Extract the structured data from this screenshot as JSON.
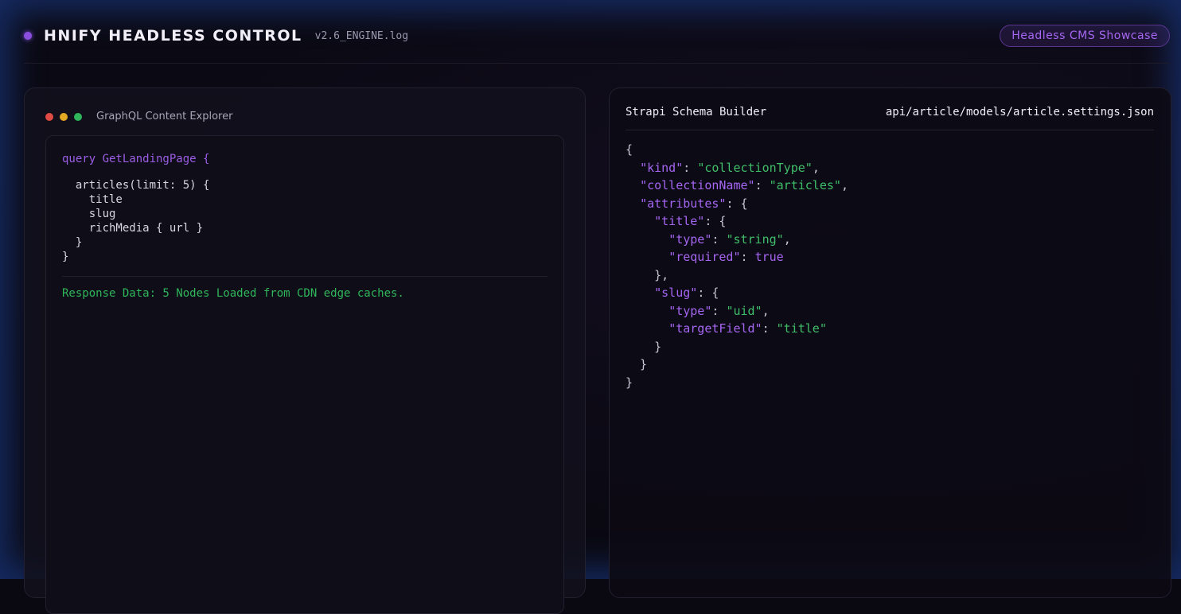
{
  "header": {
    "brand": "HNIFY HEADLESS CONTROL",
    "version": "v2.6_ENGINE.log",
    "badge": "Headless CMS Showcase"
  },
  "left_panel": {
    "title": "GraphQL Content Explorer",
    "query_lines": [
      "query GetLandingPage {",
      "  articles(limit: 5) {",
      "    title",
      "    slug",
      "    richMedia { url }",
      "  }",
      "}"
    ],
    "response": "Response Data: 5 Nodes Loaded from CDN edge caches."
  },
  "right_panel": {
    "title": "Strapi Schema Builder",
    "path": "api/article/models/article.settings.json",
    "json": {
      "open": "{",
      "kind_key": "\"kind\"",
      "kind_val": "\"collectionType\"",
      "cname_key": "\"collectionName\"",
      "cname_val": "\"articles\"",
      "attr_key": "\"attributes\"",
      "title_key": "\"title\"",
      "type_key": "\"type\"",
      "title_type_val": "\"string\"",
      "required_key": "\"required\"",
      "required_val": "true",
      "slug_key": "\"slug\"",
      "slug_type_val": "\"uid\"",
      "target_key": "\"targetField\"",
      "target_val": "\"title\"",
      "close": "}"
    }
  }
}
